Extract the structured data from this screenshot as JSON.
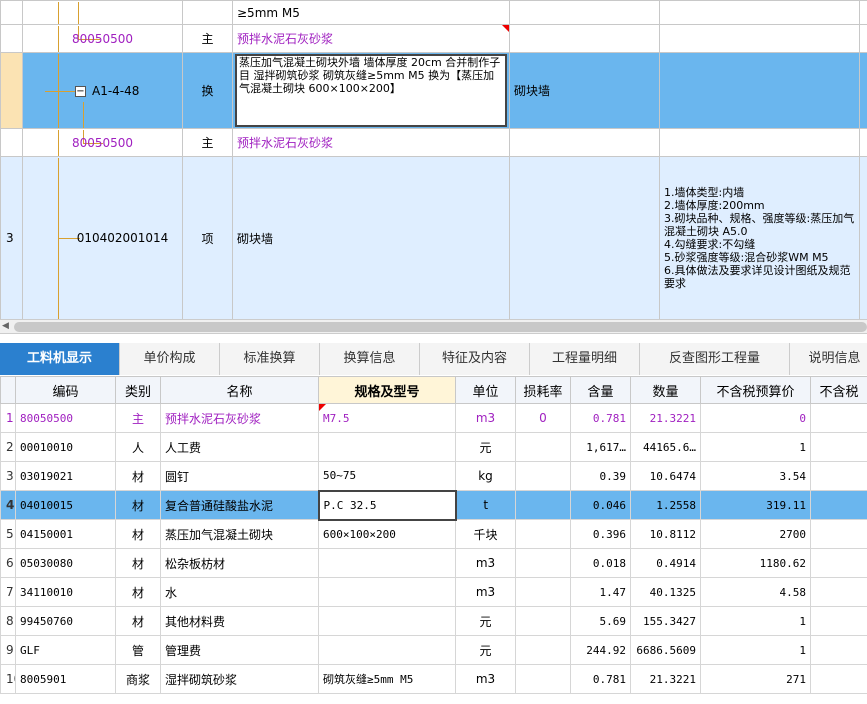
{
  "upper_rows": [
    {
      "kind": "partial",
      "idx": "",
      "code": "",
      "type": "",
      "name": "≥5mm M5",
      "feature": "",
      "desc": ""
    },
    {
      "kind": "material",
      "idx": "",
      "code": "80050500",
      "type": "主",
      "name": "预拌水泥石灰砂浆",
      "feature": "",
      "desc": ""
    },
    {
      "kind": "selected",
      "idx": "",
      "code": "A1-4-48",
      "type": "换",
      "name": "蒸压加气混凝土砌块外墙 墙体厚度 20cm 合并制作子目 湿拌砌筑砂浆 砌筑灰缝≥5mm M5  换为【蒸压加气混凝土砌块 600×100×200】",
      "feature": "砌块墙",
      "desc": ""
    },
    {
      "kind": "material",
      "idx": "",
      "code": "80050500",
      "type": "主",
      "name": "预拌水泥石灰砂浆",
      "feature": "",
      "desc": ""
    },
    {
      "kind": "item",
      "idx": "3",
      "code": "010402001014",
      "type": "项",
      "name": "砌块墙",
      "feature": "",
      "desc": "1.墙体类型:内墙\n2.墙体厚度:200mm\n3.砌块品种、规格、强度等级:蒸压加气混凝土砌块 A5.0\n4.勾缝要求:不勾缝\n5.砂浆强度等级:混合砂浆WM M5\n6.具体做法及要求详见设计图纸及规范要求"
    }
  ],
  "tabs": [
    "工料机显示",
    "单价构成",
    "标准换算",
    "换算信息",
    "特征及内容",
    "工程量明细",
    "反查图形工程量",
    "说明信息"
  ],
  "columns": [
    "编码",
    "类别",
    "名称",
    "规格及型号",
    "单位",
    "损耗率",
    "含量",
    "数量",
    "不含税预算价",
    "不含税"
  ],
  "rows": [
    {
      "idx": "1",
      "code": "80050500",
      "cat": "主",
      "name": "预拌水泥石灰砂浆",
      "spec": "M7.5",
      "unit": "m3",
      "loss": "0",
      "content": "0.781",
      "qty": "21.3221",
      "price": "0"
    },
    {
      "idx": "2",
      "code": "00010010",
      "cat": "人",
      "name": "人工费",
      "spec": "",
      "unit": "元",
      "loss": "",
      "content": "1,617…",
      "qty": "44165.6…",
      "price": "1"
    },
    {
      "idx": "3",
      "code": "03019021",
      "cat": "材",
      "name": "圆钉",
      "spec": "50~75",
      "unit": "kg",
      "loss": "",
      "content": "0.39",
      "qty": "10.6474",
      "price": "3.54"
    },
    {
      "idx": "4",
      "code": "04010015",
      "cat": "材",
      "name": "复合普通硅酸盐水泥",
      "spec": "P.C 32.5",
      "unit": "t",
      "loss": "",
      "content": "0.046",
      "qty": "1.2558",
      "price": "319.11"
    },
    {
      "idx": "5",
      "code": "04150001",
      "cat": "材",
      "name": "蒸压加气混凝土砌块",
      "spec": "600×100×200",
      "unit": "千块",
      "loss": "",
      "content": "0.396",
      "qty": "10.8112",
      "price": "2700"
    },
    {
      "idx": "6",
      "code": "05030080",
      "cat": "材",
      "name": "松杂板枋材",
      "spec": "",
      "unit": "m3",
      "loss": "",
      "content": "0.018",
      "qty": "0.4914",
      "price": "1180.62"
    },
    {
      "idx": "7",
      "code": "34110010",
      "cat": "材",
      "name": "水",
      "spec": "",
      "unit": "m3",
      "loss": "",
      "content": "1.47",
      "qty": "40.1325",
      "price": "4.58"
    },
    {
      "idx": "8",
      "code": "99450760",
      "cat": "材",
      "name": "其他材料费",
      "spec": "",
      "unit": "元",
      "loss": "",
      "content": "5.69",
      "qty": "155.3427",
      "price": "1"
    },
    {
      "idx": "9",
      "code": "GLF",
      "cat": "管",
      "name": "管理费",
      "spec": "",
      "unit": "元",
      "loss": "",
      "content": "244.92",
      "qty": "6686.5609",
      "price": "1"
    },
    {
      "idx": "10",
      "code": "8005901",
      "cat": "商浆",
      "name": "湿拌砌筑砂浆",
      "spec": "砌筑灰缝≥5mm M5",
      "unit": "m3",
      "loss": "",
      "content": "0.781",
      "qty": "21.3221",
      "price": "271"
    }
  ],
  "colors": {
    "selected": "#6ab6ee",
    "tab_active": "#2b80cf",
    "material_text": "#a020c0"
  }
}
